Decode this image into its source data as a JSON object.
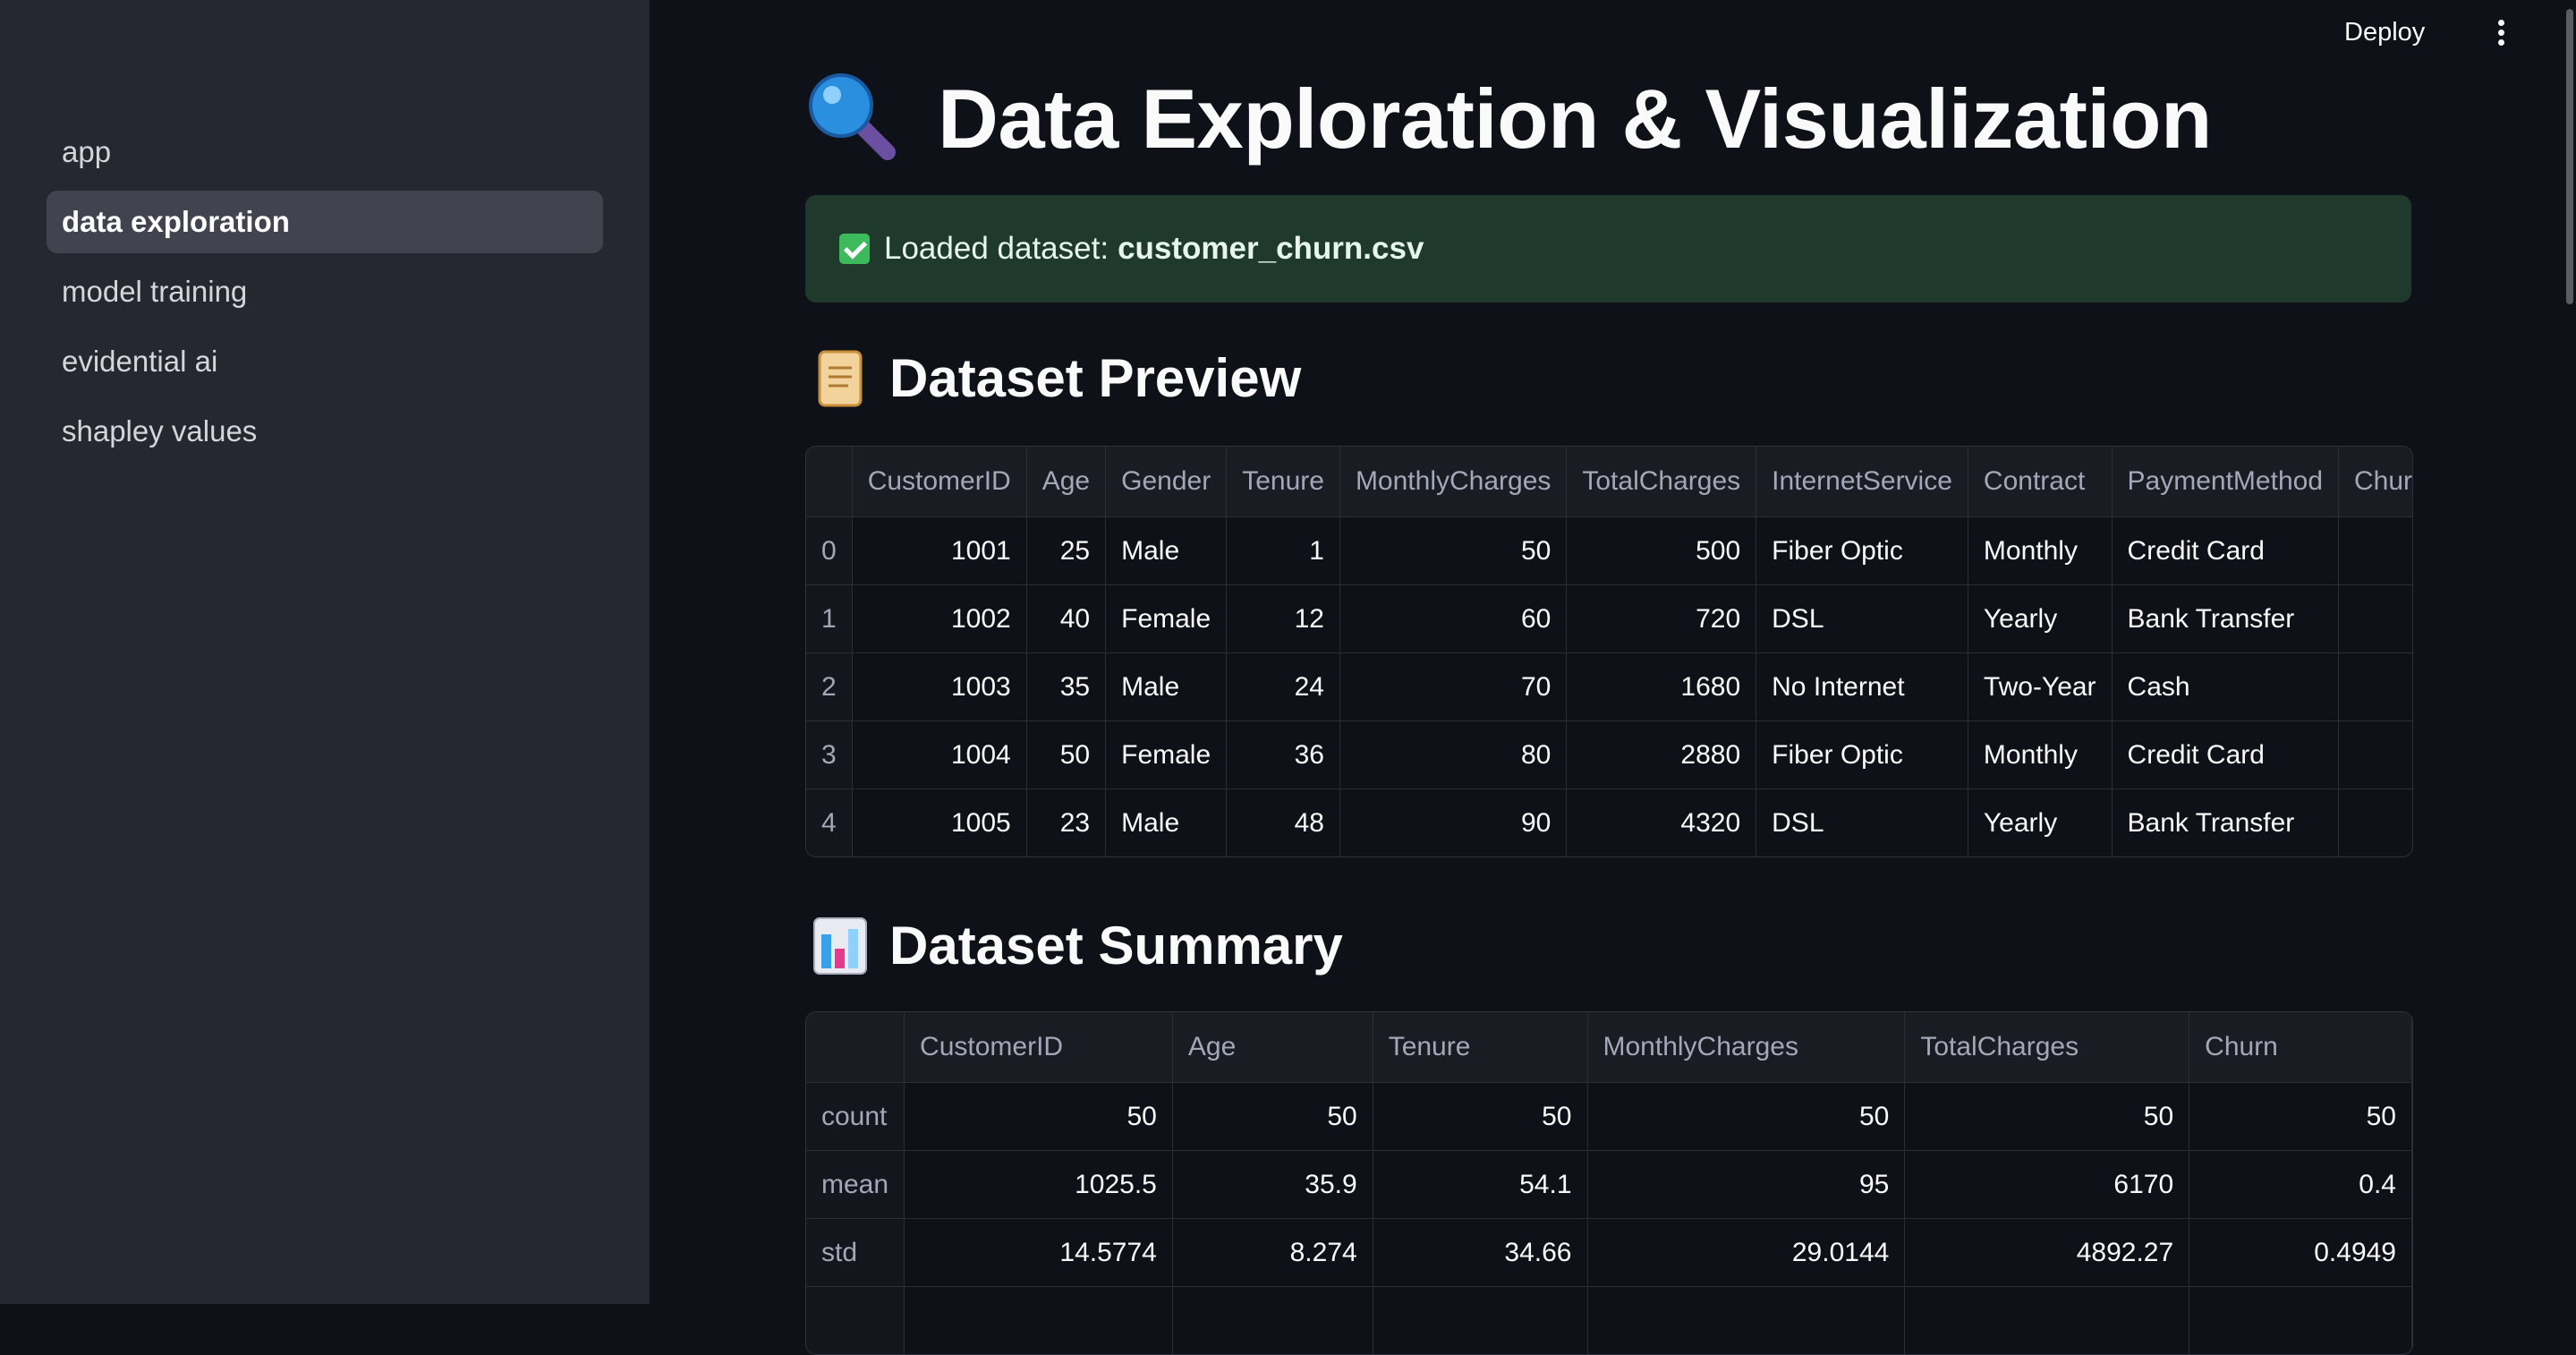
{
  "sidebar": {
    "items": [
      {
        "label": "app",
        "active": false
      },
      {
        "label": "data exploration",
        "active": true
      },
      {
        "label": "model training",
        "active": false
      },
      {
        "label": "evidential ai",
        "active": false
      },
      {
        "label": "shapley values",
        "active": false
      }
    ]
  },
  "header": {
    "deploy_label": "Deploy",
    "menu_icon": "kebab-menu-icon"
  },
  "page": {
    "title": "Data Exploration & Visualization",
    "title_icon": "magnifying-glass-icon"
  },
  "alert": {
    "icon": "check-icon",
    "text": "Loaded dataset:",
    "filename": "customer_churn.csv",
    "color": "#1f3a2c"
  },
  "preview": {
    "title": "Dataset Preview",
    "icon": "scroll-icon",
    "columns": [
      "",
      "CustomerID",
      "Age",
      "Gender",
      "Tenure",
      "MonthlyCharges",
      "TotalCharges",
      "InternetService",
      "Contract",
      "PaymentMethod",
      "Chur"
    ],
    "rows": [
      [
        "0",
        "1001",
        "25",
        "Male",
        "1",
        "50",
        "500",
        "Fiber Optic",
        "Monthly",
        "Credit Card",
        ""
      ],
      [
        "1",
        "1002",
        "40",
        "Female",
        "12",
        "60",
        "720",
        "DSL",
        "Yearly",
        "Bank Transfer",
        ""
      ],
      [
        "2",
        "1003",
        "35",
        "Male",
        "24",
        "70",
        "1680",
        "No Internet",
        "Two-Year",
        "Cash",
        ""
      ],
      [
        "3",
        "1004",
        "50",
        "Female",
        "36",
        "80",
        "2880",
        "Fiber Optic",
        "Monthly",
        "Credit Card",
        ""
      ],
      [
        "4",
        "1005",
        "23",
        "Male",
        "48",
        "90",
        "4320",
        "DSL",
        "Yearly",
        "Bank Transfer",
        ""
      ]
    ]
  },
  "summary": {
    "title": "Dataset Summary",
    "icon": "bar-chart-icon",
    "columns": [
      "",
      "CustomerID",
      "Age",
      "Tenure",
      "MonthlyCharges",
      "TotalCharges",
      "Churn"
    ],
    "rows": [
      [
        "count",
        "50",
        "50",
        "50",
        "50",
        "50",
        "50"
      ],
      [
        "mean",
        "1025.5",
        "35.9",
        "54.1",
        "95",
        "6170",
        "0.4"
      ],
      [
        "std",
        "14.5774",
        "8.274",
        "34.66",
        "29.0144",
        "4892.27",
        "0.4949"
      ]
    ]
  }
}
